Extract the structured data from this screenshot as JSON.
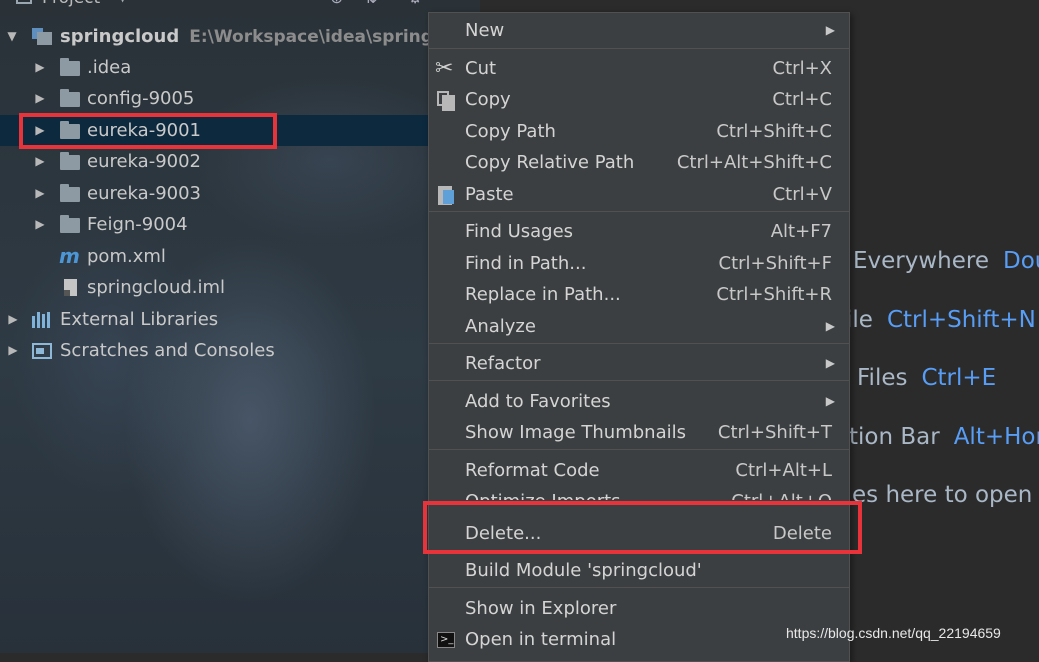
{
  "panel": {
    "title": "Project"
  },
  "tree": [
    {
      "label": "springcloud",
      "path": "E:\\Workspace\\idea\\springclou",
      "icon": "module-icon",
      "expanded": true
    },
    {
      "label": ".idea",
      "icon": "folder-icon"
    },
    {
      "label": "config-9005",
      "icon": "folder-icon"
    },
    {
      "label": "eureka-9001",
      "icon": "folder-icon",
      "selected": true
    },
    {
      "label": "eureka-9002",
      "icon": "folder-icon"
    },
    {
      "label": "eureka-9003",
      "icon": "folder-icon"
    },
    {
      "label": "Feign-9004",
      "icon": "folder-icon"
    },
    {
      "label": "pom.xml",
      "icon": "maven-icon"
    },
    {
      "label": "springcloud.iml",
      "icon": "iml-file-icon"
    },
    {
      "label": "External Libraries",
      "icon": "libraries-icon"
    },
    {
      "label": "Scratches and Consoles",
      "icon": "scratches-icon"
    }
  ],
  "menu": {
    "new": {
      "label": "New"
    },
    "cut": {
      "label": "Cut",
      "shortcut": "Ctrl+X"
    },
    "copy": {
      "label": "Copy",
      "shortcut": "Ctrl+C"
    },
    "copy_path": {
      "label": "Copy Path",
      "shortcut": "Ctrl+Shift+C"
    },
    "copy_relative_path": {
      "label": "Copy Relative Path",
      "shortcut": "Ctrl+Alt+Shift+C"
    },
    "paste": {
      "label": "Paste",
      "shortcut": "Ctrl+V"
    },
    "find_usages": {
      "label": "Find Usages",
      "shortcut": "Alt+F7"
    },
    "find_in_path": {
      "label": "Find in Path...",
      "shortcut": "Ctrl+Shift+F"
    },
    "replace_in_path": {
      "label": "Replace in Path...",
      "shortcut": "Ctrl+Shift+R"
    },
    "analyze": {
      "label": "Analyze"
    },
    "refactor": {
      "label": "Refactor"
    },
    "add_to_favorites": {
      "label": "Add to Favorites"
    },
    "show_image_thumbnails": {
      "label": "Show Image Thumbnails",
      "shortcut": "Ctrl+Shift+T"
    },
    "reformat_code": {
      "label": "Reformat Code",
      "shortcut": "Ctrl+Alt+L"
    },
    "optimize_imports": {
      "label": "Optimize Imports",
      "shortcut": "Ctrl+Alt+O"
    },
    "delete": {
      "label": "Delete...",
      "shortcut": "Delete"
    },
    "build_module": {
      "label": "Build Module 'springcloud'"
    },
    "show_in_explorer": {
      "label": "Show in Explorer"
    },
    "open_in_terminal": {
      "label": "Open in terminal"
    }
  },
  "hints": [
    {
      "text": "Everywhere",
      "key": "Dou"
    },
    {
      "text": "ile",
      "key": "Ctrl+Shift+N"
    },
    {
      "text": "Files",
      "key": "Ctrl+E"
    },
    {
      "text": "tion Bar",
      "key": "Alt+Hor"
    },
    {
      "text": "es here to open",
      "key": ""
    }
  ],
  "colors": {
    "highlight": "#e8333a",
    "selection": "#0d293e",
    "menu_bg": "#3c3f41",
    "accent_key": "#589df6"
  },
  "watermark": "https://blog.csdn.net/qq_22194659"
}
